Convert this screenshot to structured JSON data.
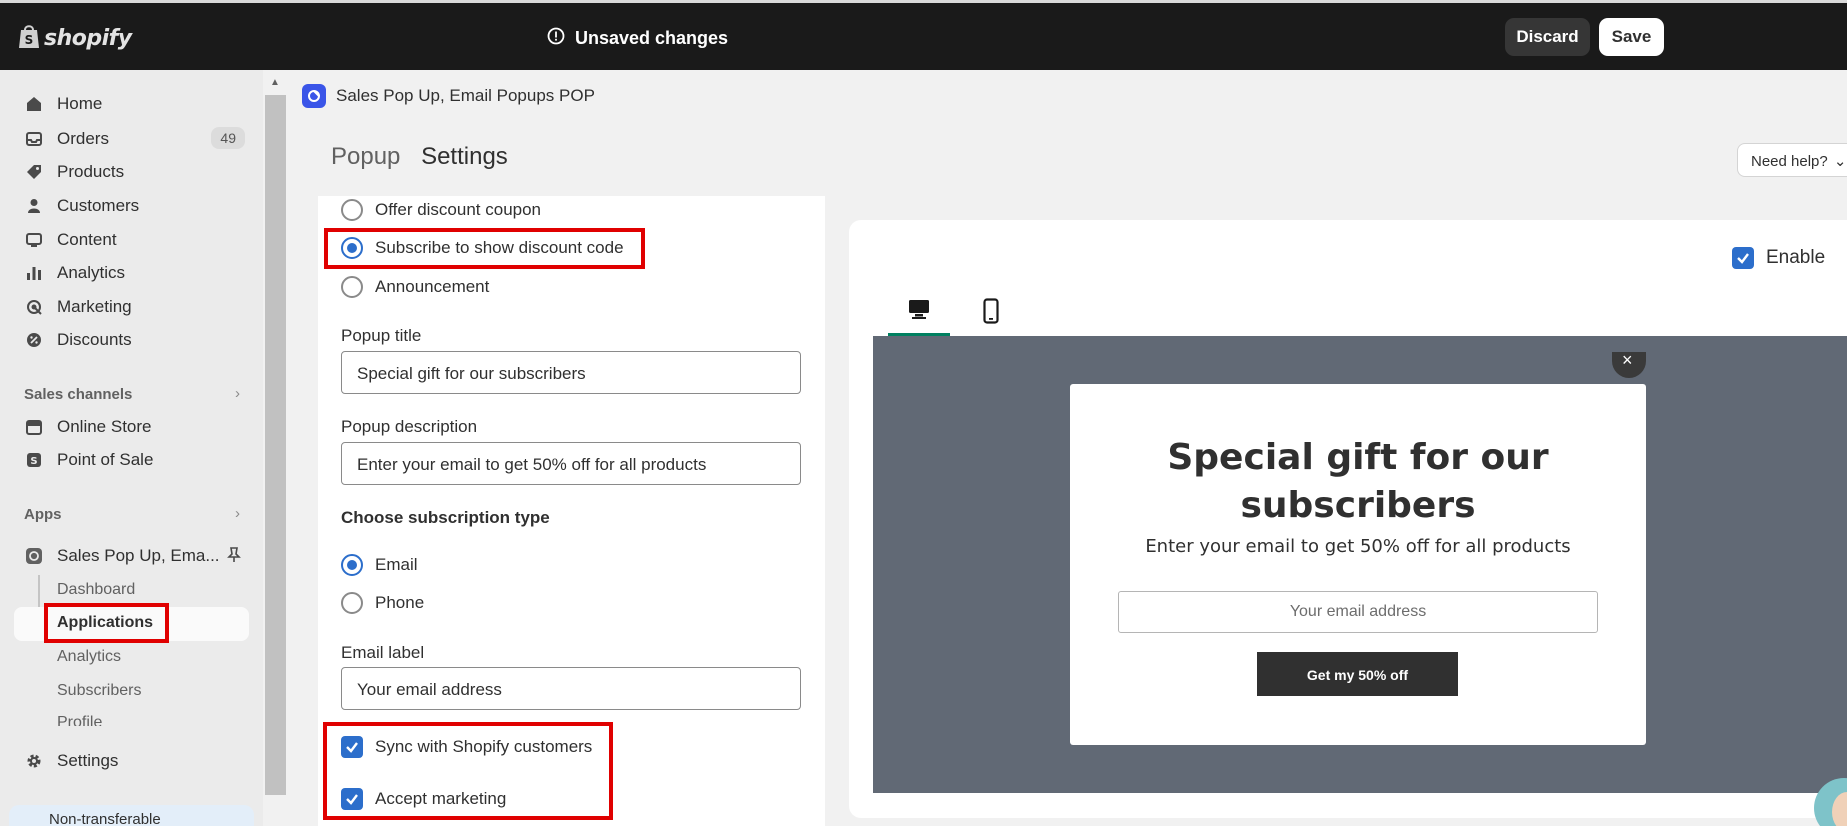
{
  "topbar": {
    "logo_text": "shopify",
    "unsaved_label": "Unsaved changes",
    "discard_label": "Discard",
    "save_label": "Save"
  },
  "sidebar": {
    "items": [
      {
        "label": "Home",
        "icon": "home-icon"
      },
      {
        "label": "Orders",
        "icon": "inbox-icon",
        "badge": "49"
      },
      {
        "label": "Products",
        "icon": "tag-icon"
      },
      {
        "label": "Customers",
        "icon": "person-icon"
      },
      {
        "label": "Content",
        "icon": "monitor-icon"
      },
      {
        "label": "Analytics",
        "icon": "bar-chart-icon"
      },
      {
        "label": "Marketing",
        "icon": "target-icon"
      },
      {
        "label": "Discounts",
        "icon": "discount-icon"
      }
    ],
    "sales_channels_label": "Sales channels",
    "channels": [
      {
        "label": "Online Store",
        "icon": "store-icon"
      },
      {
        "label": "Point of Sale",
        "icon": "pos-icon"
      }
    ],
    "apps_label": "Apps",
    "app_name": "Sales Pop Up, Ema...",
    "app_subitems": [
      "Dashboard",
      "Applications",
      "Analytics",
      "Subscribers",
      "Profile"
    ],
    "settings_label": "Settings",
    "bottom_banner": "Non-transferable"
  },
  "header": {
    "app_title": "Sales Pop Up, Email Popups POP",
    "breadcrumb": "Popup",
    "page_title": "Settings",
    "need_help": "Need help?"
  },
  "form": {
    "popup_types": [
      {
        "label": "Offer discount coupon",
        "selected": false
      },
      {
        "label": "Subscribe to show discount code",
        "selected": true
      },
      {
        "label": "Announcement",
        "selected": false
      }
    ],
    "popup_title_label": "Popup title",
    "popup_title_value": "Special gift for our subscribers",
    "popup_description_label": "Popup description",
    "popup_description_value": "Enter your email to get 50% off for all products",
    "subscription_type_label": "Choose subscription type",
    "subscription_types": [
      {
        "label": "Email",
        "selected": true
      },
      {
        "label": "Phone",
        "selected": false
      }
    ],
    "email_label_label": "Email label",
    "email_label_value": "Your email address",
    "sync_label": "Sync with Shopify customers",
    "sync_checked": true,
    "accept_marketing_label": "Accept marketing",
    "accept_marketing_checked": true
  },
  "preview": {
    "enable_label": "Enable",
    "enable_checked": true,
    "tabs": [
      "desktop-icon",
      "mobile-icon"
    ],
    "popup_title": "Special gift for our subscribers",
    "popup_desc": "Enter your email to get 50% off for all products",
    "email_placeholder": "Your email address",
    "button_label": "Get my 50% off"
  },
  "colors": {
    "topbar": "#1a1a1a",
    "accent": "#2c6ecb",
    "highlight": "#e00000",
    "preview_bg": "#616975",
    "tab_active": "#008060"
  }
}
